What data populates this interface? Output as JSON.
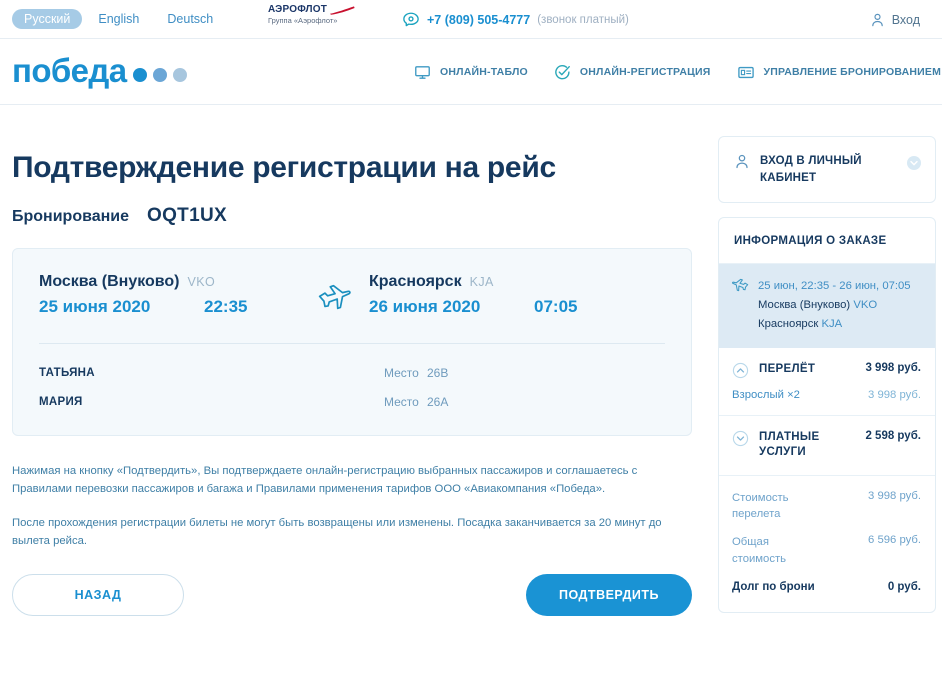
{
  "topbar": {
    "languages": [
      {
        "label": "Русский",
        "active": true
      },
      {
        "label": "English",
        "active": false
      },
      {
        "label": "Deutsch",
        "active": false
      }
    ],
    "partner_logo": {
      "word": "АЭРОФЛОТ",
      "subtitle": "Группа «Аэрофлот»",
      "text_color": "#1b3668",
      "swoosh_color": "#c8102e"
    },
    "phone": "+7 (809) 505-4777",
    "phone_note": "(звонок платный)",
    "phone_icon": "phone-icon",
    "login_label": "Вход",
    "login_icon": "user-icon"
  },
  "header": {
    "logo_word": "победа",
    "logo_dots": [
      "#1a8fd0",
      "#6ba6d6",
      "#a7c6de"
    ],
    "nav": [
      {
        "label": "ОНЛАЙН-ТАБЛО",
        "icon": "monitor-icon"
      },
      {
        "label": "ОНЛАЙН-РЕГИСТРАЦИЯ",
        "icon": "check-circle-icon"
      },
      {
        "label": "УПРАВЛЕНИЕ БРОНИРОВАНИЕМ",
        "icon": "id-card-icon"
      }
    ]
  },
  "main": {
    "title": "Подтверждение регистрации на рейс",
    "booking_label": "Бронирование",
    "booking_code": "OQT1UX",
    "flight": {
      "plane_icon": "airplane-icon",
      "departure": {
        "city": "Москва (Внуково)",
        "code": "VKO",
        "date": "25 июня 2020",
        "time": "22:35"
      },
      "arrival": {
        "city": "Красноярск",
        "code": "KJA",
        "date": "26 июня 2020",
        "time": "07:05"
      }
    },
    "seat_label": "Место",
    "passengers": [
      {
        "name": "ТАТЬЯНА",
        "seat_label": "Место",
        "seat": "26B"
      },
      {
        "name": "МАРИЯ",
        "seat_label": "Место",
        "seat": "26A"
      }
    ],
    "legal": [
      "Нажимая на кнопку «Подтвердить», Вы подтверждаете онлайн-регистрацию выбранных пассажиров и соглашаетесь с Правилами перевозки пассажиров и багажа и Правилами применения тарифов ООО «Авиакомпания «Победа».",
      "После прохождения регистрации билеты не могут быть возвращены или изменены. Посадка заканчивается за 20 минут до вылета рейса."
    ],
    "back_button": "НАЗАД",
    "confirm_button": "ПОДТВЕРДИТЬ"
  },
  "sidebar": {
    "cabinet": {
      "label": "ВХОД В ЛИЧНЫЙ КАБИНЕТ",
      "user_icon": "user-icon",
      "chevron_icon": "chevron-down-icon"
    },
    "order": {
      "title": "ИНФОРМАЦИЯ О ЗАКАЗЕ",
      "flight_icon": "airplane-icon",
      "dates": "25 июн, 22:35 - 26 июн, 07:05",
      "from_city": "Москва (Внуково)",
      "from_code": "VKO",
      "to_city": "Красноярск",
      "to_code": "KJA",
      "highlight_bg": "#ddeaf4"
    },
    "price_sections": [
      {
        "title": "ПЕРЕЛЁТ",
        "amount": "3 998 руб.",
        "expanded": true,
        "chevron_icon": "chevron-up-circle-icon",
        "rows": [
          {
            "label": "Взрослый ×2",
            "value": "3 998 руб."
          }
        ]
      },
      {
        "title": "ПЛАТНЫЕ УСЛУГИ",
        "amount": "2 598 руб.",
        "expanded": false,
        "chevron_icon": "chevron-down-circle-icon",
        "rows": []
      }
    ],
    "totals": [
      {
        "label": "Стоимость перелета",
        "value": "3 998 руб.",
        "strong": false
      },
      {
        "label": "Общая стоимость",
        "value": "6 596 руб.",
        "strong": false
      },
      {
        "label": "Долг по брони",
        "value": "0 руб.",
        "strong": true
      }
    ]
  },
  "colors": {
    "brand_blue": "#1a8fd0",
    "dark_navy": "#16395f",
    "accent_cyan": "#1a93d4",
    "card_bg": "#f4f9fc",
    "border": "#e2edf4"
  }
}
